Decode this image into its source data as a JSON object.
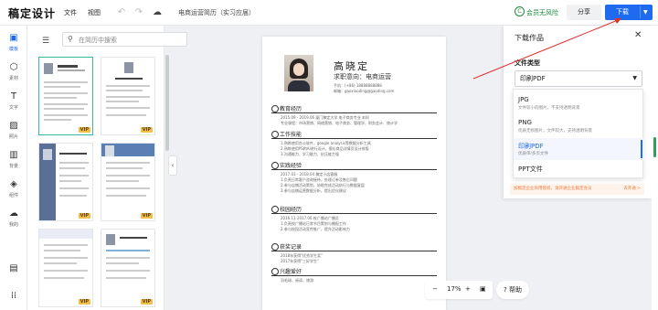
{
  "app": {
    "logo": "稿定设计",
    "menus": [
      "文件",
      "视图"
    ],
    "doc_title": "电商运营简历（实习应届）",
    "vip_label": "会员无风险",
    "share_label": "分享",
    "download_label": "下载"
  },
  "rail": [
    {
      "label": "模板",
      "icon": "template-icon",
      "active": true
    },
    {
      "label": "素材",
      "icon": "shapes-icon"
    },
    {
      "label": "文字",
      "icon": "text-icon"
    },
    {
      "label": "照片",
      "icon": "image-icon"
    },
    {
      "label": "背景",
      "icon": "background-icon"
    },
    {
      "label": "组件",
      "icon": "component-icon"
    },
    {
      "label": "我的",
      "icon": "cloud-upload-icon"
    }
  ],
  "search": {
    "placeholder": "在简历中搜索"
  },
  "templates": {
    "vip_badge": "VIP"
  },
  "resume": {
    "name": "高晓定",
    "intention": "求职意向：电商运营",
    "phone": "手机：(+86) 18888888888",
    "email": "邮箱：gaoxiaoding@gaoding.com",
    "sections": [
      {
        "title": "教育经历",
        "lines": [
          "2015.09 - 2019.06        厦门稿定大学        电子商务专业        本科",
          "专业课程：市场营销、网络营销、电子商务、管理学、财务会计、统计学"
        ]
      },
      {
        "title": "工作技能",
        "lines": [
          "1.熟练使用办公软件，google analysis等数据分析工具",
          "2.熟练使用PS和AI进行设计，擅长商品详情页设计排版",
          "3.沟通能力、学习能力、抗压能力强"
        ]
      },
      {
        "title": "实践经验",
        "lines": [
          "2017.03 - 2018.04        稿定小店客服",
          "1.负责日常客户咨询接待，处理订单及售后问题",
          "2.参与店铺活动策划，协助完成活动执行与数据复盘",
          "3.参与店铺运营数据分析，提出优化建议"
        ]
      },
      {
        "title": "校园经历",
        "lines": [
          "2016.11-2017.06        校广播站广播员",
          "1.负责校广播站日常节目策划与播报工作",
          "2.参与校园活动宣传推广，提升活动影响力"
        ]
      },
      {
        "title": "获奖记录",
        "lines": [
          "2018年获得\"优秀学生奖\"",
          "2017年获得\"三好学生\""
        ]
      },
      {
        "title": "兴趣爱好",
        "lines": [
          "羽毛球、阅读、旅游"
        ]
      }
    ]
  },
  "zoom": {
    "value": "17%",
    "minus": "−",
    "plus": "+"
  },
  "help": {
    "label": "? 帮助"
  },
  "download_panel": {
    "title": "下载作品",
    "file_type_label": "文件类型",
    "selected": "印刷PDF",
    "options": [
      {
        "name": "JPG",
        "desc": "文件较小的图片，不支持透明背景"
      },
      {
        "name": "PNG",
        "desc": "优质无损图片，文件较大，支持透明背景"
      },
      {
        "name": "印刷PDF",
        "desc": "优质单/多页文件"
      },
      {
        "name": "PPT文件",
        "desc": ""
      }
    ],
    "promo": "加稿定企业商用授权，请开通企业稿定会员",
    "promo_link": "去开通 >"
  },
  "colors": {
    "accent": "#1f6bf0",
    "vip": "#1a8a3a",
    "annotation_arrow": "#e03030"
  }
}
